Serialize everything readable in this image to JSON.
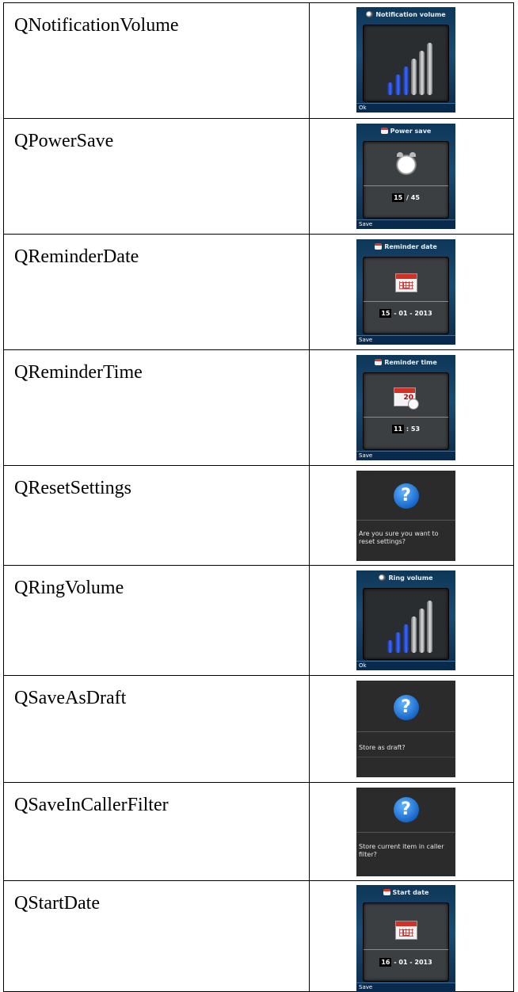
{
  "rows": [
    {
      "name": "QNotificationVolume",
      "title": "Notification volume",
      "softkey": "Ok",
      "volume_level": 3,
      "volume_max": 6
    },
    {
      "name": "QPowerSave",
      "title": "Power save",
      "softkey": "Save",
      "value_selected": "15",
      "value_rest": "/ 45"
    },
    {
      "name": "QReminderDate",
      "title": "Reminder date",
      "softkey": "Save",
      "value_selected": "15",
      "value_rest": "- 01 - 2013"
    },
    {
      "name": "QReminderTime",
      "title": "Reminder time",
      "softkey": "Save",
      "value_selected": "11",
      "value_rest": ": 53",
      "icon_day": "20"
    },
    {
      "name": "QResetSettings",
      "message": "Are you sure you want to reset settings?",
      "icon_glyph": "?"
    },
    {
      "name": "QRingVolume",
      "title": "Ring volume",
      "softkey": "Ok",
      "volume_level": 3,
      "volume_max": 6
    },
    {
      "name": "QSaveAsDraft",
      "message": "Store as draft?",
      "icon_glyph": "?"
    },
    {
      "name": "QSaveInCallerFilter",
      "message": "Store current item in caller filter?",
      "icon_glyph": "?"
    },
    {
      "name": "QStartDate",
      "title": "Start date",
      "softkey": "Save",
      "value_selected": "16",
      "value_rest": "- 01 - 2013"
    }
  ],
  "icons": {
    "title_speaker": "speaker-icon",
    "title_calendar": "calendar-icon",
    "power_save": "alarm-clock-icon",
    "date": "calendar-icon",
    "time": "calendar-clock-icon",
    "question": "question-icon"
  }
}
